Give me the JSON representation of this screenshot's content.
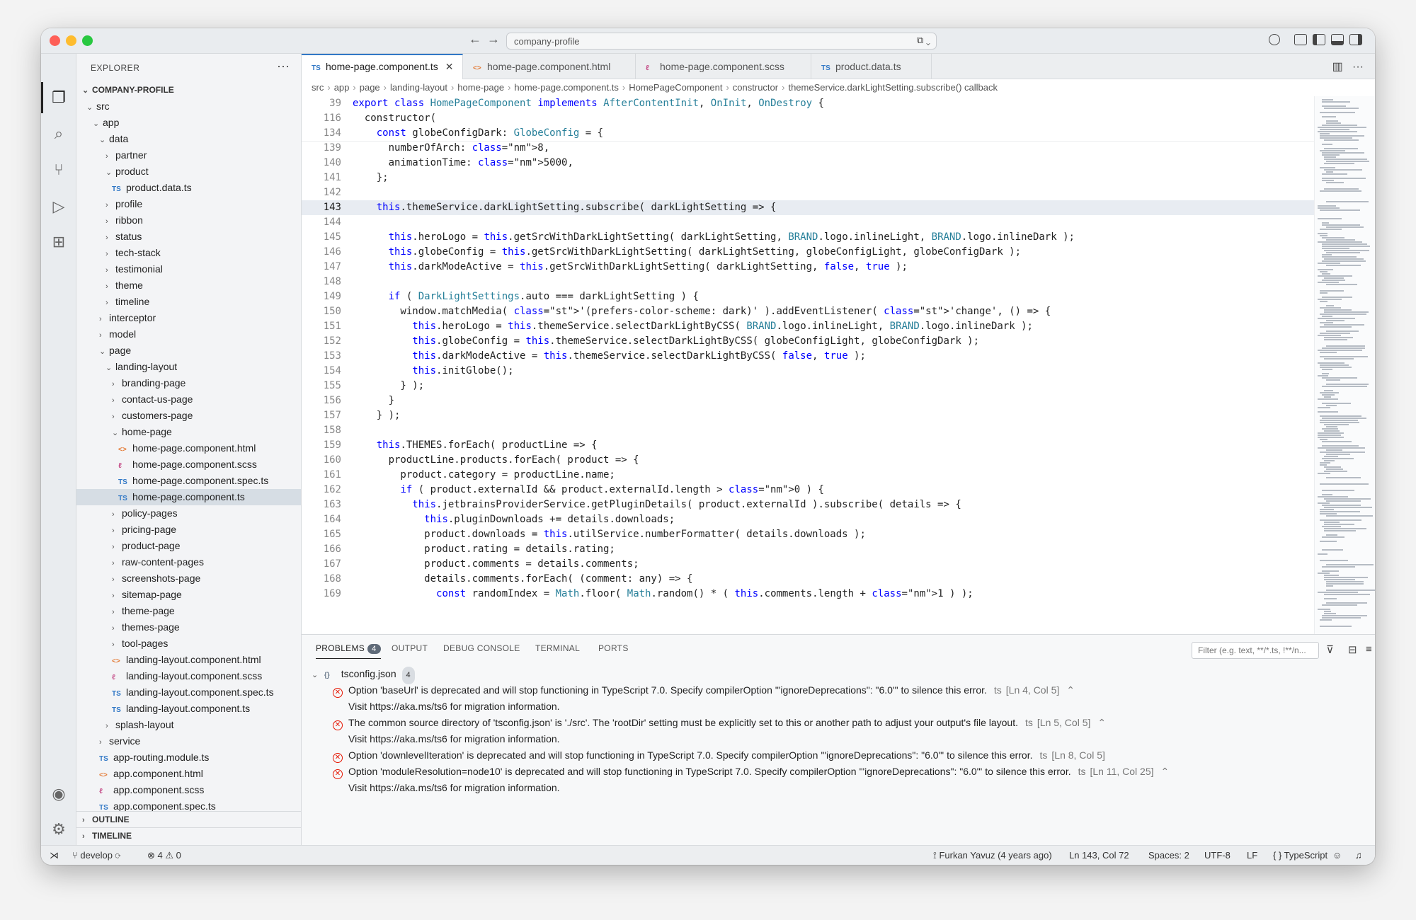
{
  "titlebar": {
    "search_text": "company-profile"
  },
  "explorer": {
    "title": "EXPLORER",
    "root": "COMPANY-PROFILE",
    "tree": [
      {
        "label": "src",
        "depth": 0,
        "kind": "folder-open"
      },
      {
        "label": "app",
        "depth": 1,
        "kind": "folder-open"
      },
      {
        "label": "data",
        "depth": 2,
        "kind": "folder-open"
      },
      {
        "label": "partner",
        "depth": 3,
        "kind": "folder"
      },
      {
        "label": "product",
        "depth": 3,
        "kind": "folder-open"
      },
      {
        "label": "product.data.ts",
        "depth": 4,
        "kind": "ts"
      },
      {
        "label": "profile",
        "depth": 3,
        "kind": "folder"
      },
      {
        "label": "ribbon",
        "depth": 3,
        "kind": "folder"
      },
      {
        "label": "status",
        "depth": 3,
        "kind": "folder"
      },
      {
        "label": "tech-stack",
        "depth": 3,
        "kind": "folder"
      },
      {
        "label": "testimonial",
        "depth": 3,
        "kind": "folder"
      },
      {
        "label": "theme",
        "depth": 3,
        "kind": "folder"
      },
      {
        "label": "timeline",
        "depth": 3,
        "kind": "folder"
      },
      {
        "label": "interceptor",
        "depth": 2,
        "kind": "folder"
      },
      {
        "label": "model",
        "depth": 2,
        "kind": "folder"
      },
      {
        "label": "page",
        "depth": 2,
        "kind": "folder-open"
      },
      {
        "label": "landing-layout",
        "depth": 3,
        "kind": "folder-open"
      },
      {
        "label": "branding-page",
        "depth": 4,
        "kind": "folder"
      },
      {
        "label": "contact-us-page",
        "depth": 4,
        "kind": "folder"
      },
      {
        "label": "customers-page",
        "depth": 4,
        "kind": "folder"
      },
      {
        "label": "home-page",
        "depth": 4,
        "kind": "folder-open"
      },
      {
        "label": "home-page.component.html",
        "depth": 5,
        "kind": "html"
      },
      {
        "label": "home-page.component.scss",
        "depth": 5,
        "kind": "scss"
      },
      {
        "label": "home-page.component.spec.ts",
        "depth": 5,
        "kind": "ts"
      },
      {
        "label": "home-page.component.ts",
        "depth": 5,
        "kind": "ts",
        "selected": true
      },
      {
        "label": "policy-pages",
        "depth": 4,
        "kind": "folder"
      },
      {
        "label": "pricing-page",
        "depth": 4,
        "kind": "folder"
      },
      {
        "label": "product-page",
        "depth": 4,
        "kind": "folder"
      },
      {
        "label": "raw-content-pages",
        "depth": 4,
        "kind": "folder"
      },
      {
        "label": "screenshots-page",
        "depth": 4,
        "kind": "folder"
      },
      {
        "label": "sitemap-page",
        "depth": 4,
        "kind": "folder"
      },
      {
        "label": "theme-page",
        "depth": 4,
        "kind": "folder"
      },
      {
        "label": "themes-page",
        "depth": 4,
        "kind": "folder"
      },
      {
        "label": "tool-pages",
        "depth": 4,
        "kind": "folder"
      },
      {
        "label": "landing-layout.component.html",
        "depth": 4,
        "kind": "html"
      },
      {
        "label": "landing-layout.component.scss",
        "depth": 4,
        "kind": "scss"
      },
      {
        "label": "landing-layout.component.spec.ts",
        "depth": 4,
        "kind": "ts"
      },
      {
        "label": "landing-layout.component.ts",
        "depth": 4,
        "kind": "ts"
      },
      {
        "label": "splash-layout",
        "depth": 3,
        "kind": "folder"
      },
      {
        "label": "service",
        "depth": 2,
        "kind": "folder"
      },
      {
        "label": "app-routing.module.ts",
        "depth": 2,
        "kind": "ts"
      },
      {
        "label": "app.component.html",
        "depth": 2,
        "kind": "html"
      },
      {
        "label": "app.component.scss",
        "depth": 2,
        "kind": "scss"
      },
      {
        "label": "app.component.spec.ts",
        "depth": 2,
        "kind": "ts"
      }
    ],
    "sections": [
      "OUTLINE",
      "TIMELINE"
    ]
  },
  "tabs": [
    {
      "label": "home-page.component.ts",
      "icon": "TS",
      "active": true
    },
    {
      "label": "home-page.component.html",
      "icon": "<>",
      "active": false
    },
    {
      "label": "home-page.component.scss",
      "icon": "scss",
      "active": false
    },
    {
      "label": "product.data.ts",
      "icon": "TS",
      "active": false
    }
  ],
  "breadcrumb": [
    "src",
    "app",
    "page",
    "landing-layout",
    "home-page",
    "home-page.component.ts",
    "HomePageComponent",
    "constructor",
    "themeService.darkLightSetting.subscribe() callback"
  ],
  "code_lines": [
    {
      "n": "39",
      "text": "export class HomePageComponent implements AfterContentInit, OnInit, OnDestroy {",
      "sticky": true
    },
    {
      "n": "116",
      "text": "  constructor(",
      "sticky": true
    },
    {
      "n": "134",
      "text": "    const globeConfigDark: GlobeConfig = {",
      "sticky": true
    },
    {
      "n": "139",
      "text": "      numberOfArch: 8,"
    },
    {
      "n": "140",
      "text": "      animationTime: 5000,"
    },
    {
      "n": "141",
      "text": "    };"
    },
    {
      "n": "142",
      "text": ""
    },
    {
      "n": "143",
      "text": "    this.themeService.darkLightSetting.subscribe( darkLightSetting => {",
      "current": true
    },
    {
      "n": "144",
      "text": ""
    },
    {
      "n": "145",
      "text": "      this.heroLogo = this.getSrcWithDarkLightSetting( darkLightSetting, BRAND.logo.inlineLight, BRAND.logo.inlineDark );"
    },
    {
      "n": "146",
      "text": "      this.globeConfig = this.getSrcWithDarkLightSetting( darkLightSetting, globeConfigLight, globeConfigDark );"
    },
    {
      "n": "147",
      "text": "      this.darkModeActive = this.getSrcWithDarkLightSetting( darkLightSetting, false, true );"
    },
    {
      "n": "148",
      "text": ""
    },
    {
      "n": "149",
      "text": "      if ( DarkLightSettings.auto === darkLightSetting ) {"
    },
    {
      "n": "150",
      "text": "        window.matchMedia( '(prefers-color-scheme: dark)' ).addEventListener( 'change', () => {"
    },
    {
      "n": "151",
      "text": "          this.heroLogo = this.themeService.selectDarkLightByCSS( BRAND.logo.inlineLight, BRAND.logo.inlineDark );"
    },
    {
      "n": "152",
      "text": "          this.globeConfig = this.themeService.selectDarkLightByCSS( globeConfigLight, globeConfigDark );"
    },
    {
      "n": "153",
      "text": "          this.darkModeActive = this.themeService.selectDarkLightByCSS( false, true );"
    },
    {
      "n": "154",
      "text": "          this.initGlobe();"
    },
    {
      "n": "155",
      "text": "        } );"
    },
    {
      "n": "156",
      "text": "      }"
    },
    {
      "n": "157",
      "text": "    } );"
    },
    {
      "n": "158",
      "text": ""
    },
    {
      "n": "159",
      "text": "    this.THEMES.forEach( productLine => {"
    },
    {
      "n": "160",
      "text": "      productLine.products.forEach( product => {"
    },
    {
      "n": "161",
      "text": "        product.category = productLine.name;"
    },
    {
      "n": "162",
      "text": "        if ( product.externalId && product.externalId.length > 0 ) {"
    },
    {
      "n": "163",
      "text": "          this.jetbrainsProviderService.getPluginDetails( product.externalId ).subscribe( details => {"
    },
    {
      "n": "164",
      "text": "            this.pluginDownloads += details.downloads;"
    },
    {
      "n": "165",
      "text": "            product.downloads = this.utilService.numberFormatter( details.downloads );"
    },
    {
      "n": "166",
      "text": "            product.rating = details.rating;"
    },
    {
      "n": "167",
      "text": "            product.comments = details.comments;"
    },
    {
      "n": "168",
      "text": "            details.comments.forEach( (comment: any) => {"
    },
    {
      "n": "169",
      "text": "              const randomIndex = Math.floor( Math.random() * ( this.comments.length + 1 ) );"
    }
  ],
  "panel": {
    "tabs": [
      "PROBLEMS",
      "OUTPUT",
      "DEBUG CONSOLE",
      "TERMINAL",
      "PORTS"
    ],
    "problems_count": "4",
    "filter_placeholder": "Filter (e.g. text, **/*.ts, !**/n...",
    "file": "tsconfig.json",
    "file_count": "4",
    "problems": [
      {
        "message": "Option 'baseUrl' is deprecated and will stop functioning in TypeScript 7.0. Specify compilerOption '\"ignoreDeprecations\": \"6.0\"' to silence this error.",
        "source": "ts",
        "location": "[Ln 4, Col 5]",
        "detail": "Visit https://aka.ms/ts6 for migration information."
      },
      {
        "message": "The common source directory of 'tsconfig.json' is './src'. The 'rootDir' setting must be explicitly set to this or another path to adjust your output's file layout.",
        "source": "ts",
        "location": "[Ln 5, Col 5]",
        "detail": "Visit https://aka.ms/ts6 for migration information."
      },
      {
        "message": "Option 'downlevelIteration' is deprecated and will stop functioning in TypeScript 7.0. Specify compilerOption '\"ignoreDeprecations\": \"6.0\"' to silence this error.",
        "source": "ts",
        "location": "[Ln 8, Col 5]",
        "detail": ""
      },
      {
        "message": "Option 'moduleResolution=node10' is deprecated and will stop functioning in TypeScript 7.0. Specify compilerOption '\"ignoreDeprecations\": \"6.0\"' to silence this error.",
        "source": "ts",
        "location": "[Ln 11, Col 25]",
        "detail": "Visit https://aka.ms/ts6 for migration information."
      }
    ]
  },
  "statusbar": {
    "branch": "develop",
    "errors": "4",
    "warnings": "0",
    "blame": "Furkan Yavuz (4 years ago)",
    "position": "Ln 143, Col 72",
    "spaces": "Spaces: 2",
    "encoding": "UTF-8",
    "eol": "LF",
    "language": "{ } TypeScript"
  },
  "colors": {
    "accent": "#3178c6",
    "error": "#e51400"
  }
}
